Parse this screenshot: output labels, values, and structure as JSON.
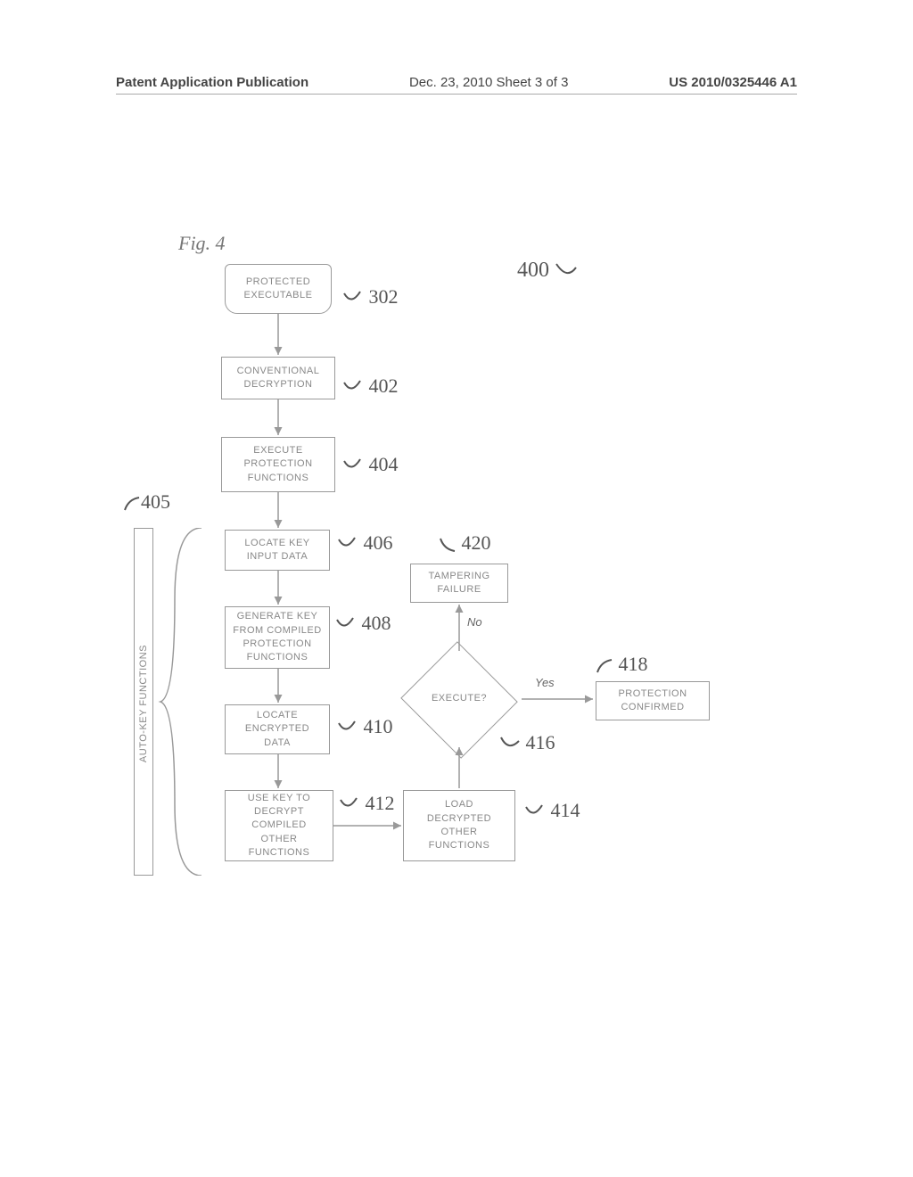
{
  "header": {
    "left": "Patent Application Publication",
    "mid": "Dec. 23, 2010  Sheet 3 of 3",
    "right": "US 2010/0325446 A1"
  },
  "figure_label": "Fig. 4",
  "top_ref": "400",
  "side_group": {
    "ref": "405",
    "label": "AUTO-KEY FUNCTIONS"
  },
  "nodes": {
    "n302": {
      "text": "PROTECTED\nEXECUTABLE",
      "ref": "302"
    },
    "n402": {
      "text": "CONVENTIONAL\nDECRYPTION",
      "ref": "402"
    },
    "n404": {
      "text": "EXECUTE\nPROTECTION\nFUNCTIONS",
      "ref": "404"
    },
    "n406": {
      "text": "LOCATE KEY\nINPUT DATA",
      "ref": "406"
    },
    "n408": {
      "text": "GENERATE KEY\nFROM COMPILED\nPROTECTION\nFUNCTIONS",
      "ref": "408"
    },
    "n410": {
      "text": "LOCATE\nENCRYPTED\nDATA",
      "ref": "410"
    },
    "n412": {
      "text": "USE KEY TO\nDECRYPT\nCOMPILED\nOTHER\nFUNCTIONS",
      "ref": "412"
    },
    "n414": {
      "text": "LOAD\nDECRYPTED\nOTHER\nFUNCTIONS",
      "ref": "414"
    },
    "n416": {
      "text": "EXECUTE?",
      "ref": "416"
    },
    "n418": {
      "text": "PROTECTION\nCONFIRMED",
      "ref": "418"
    },
    "n420": {
      "text": "TAMPERING\nFAILURE",
      "ref": "420"
    }
  },
  "edges": {
    "yes": "Yes",
    "no": "No"
  }
}
